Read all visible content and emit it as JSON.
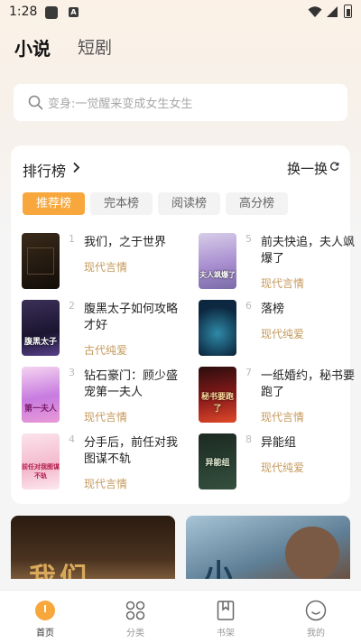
{
  "status": {
    "time": "1:28",
    "notif_letter": "A"
  },
  "header": {
    "tabs": [
      {
        "label": "小说"
      },
      {
        "label": "短剧"
      }
    ]
  },
  "search": {
    "placeholder": "变身:一觉醒来变成女生女生"
  },
  "ranking": {
    "title": "排行榜",
    "refresh_label": "换一换",
    "tabs": [
      {
        "label": "推荐榜"
      },
      {
        "label": "完本榜"
      },
      {
        "label": "阅读榜"
      },
      {
        "label": "高分榜"
      }
    ],
    "active_tab": "推荐榜",
    "books": [
      {
        "rank": "1",
        "title": "我们，之于世界",
        "genre": "现代言情",
        "cover_text": ""
      },
      {
        "rank": "2",
        "title": "腹黑太子如何攻略才好",
        "genre": "古代纯爱",
        "cover_text": "腹黑太子"
      },
      {
        "rank": "3",
        "title": "钻石豪门：顾少盛宠第一夫人",
        "genre": "现代言情",
        "cover_text": "第一夫人"
      },
      {
        "rank": "4",
        "title": "分手后，前任对我图谋不轨",
        "genre": "现代言情",
        "cover_text": "前任对我图谋不轨"
      },
      {
        "rank": "5",
        "title": "前夫快追，夫人飒爆了",
        "genre": "现代言情",
        "cover_text": "夫人飒爆了"
      },
      {
        "rank": "6",
        "title": "落榜",
        "genre": "现代纯爱",
        "cover_text": ""
      },
      {
        "rank": "7",
        "title": "一纸婚约，秘书要跑了",
        "genre": "现代言情",
        "cover_text": "秘书要跑了"
      },
      {
        "rank": "8",
        "title": "异能组",
        "genre": "现代纯爱",
        "cover_text": "异能组"
      }
    ]
  },
  "banners": [
    {
      "text": "我们"
    },
    {
      "text": "小"
    }
  ],
  "bottom_nav": [
    {
      "label": "首页",
      "icon": "home-icon",
      "active": true
    },
    {
      "label": "分类",
      "icon": "category-icon",
      "active": false
    },
    {
      "label": "书架",
      "icon": "bookshelf-icon",
      "active": false
    },
    {
      "label": "我的",
      "icon": "profile-icon",
      "active": false
    }
  ],
  "colors": {
    "accent": "#f7a73b",
    "genre": "#c49a5d"
  }
}
